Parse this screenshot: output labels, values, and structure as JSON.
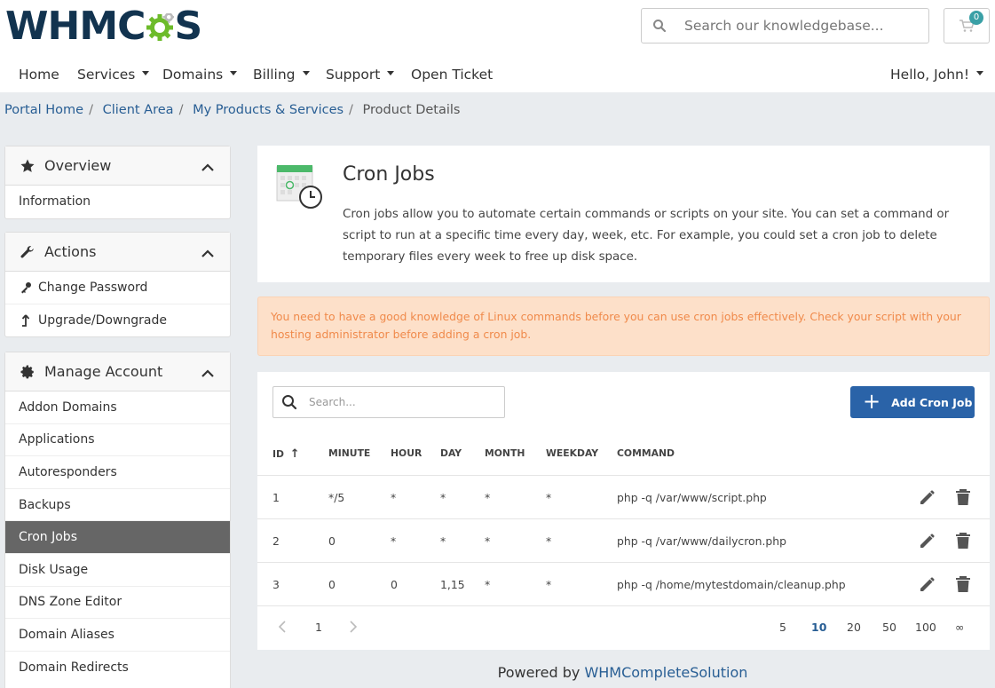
{
  "brand": {
    "logo_text_left": "WHMC",
    "logo_text_right": "S"
  },
  "header": {
    "search_placeholder": "Search our knowledgebase...",
    "cart_count": "0"
  },
  "nav": {
    "items": [
      "Home",
      "Services",
      "Domains",
      "Billing",
      "Support",
      "Open Ticket"
    ],
    "user_menu": "Hello, John!"
  },
  "breadcrumb": [
    "Portal Home",
    "Client Area",
    "My Products & Services",
    "Product Details"
  ],
  "sidebar": {
    "overview": {
      "title": "Overview",
      "items": [
        "Information"
      ]
    },
    "actions": {
      "title": "Actions",
      "items": [
        "Change Password",
        "Upgrade/Downgrade"
      ]
    },
    "manage": {
      "title": "Manage Account",
      "items": [
        "Addon Domains",
        "Applications",
        "Autoresponders",
        "Backups",
        "Cron Jobs",
        "Disk Usage",
        "DNS Zone Editor",
        "Domain Aliases",
        "Domain Redirects"
      ],
      "active": "Cron Jobs"
    }
  },
  "cron": {
    "title": "Cron Jobs",
    "description": "Cron jobs allow you to automate certain commands or scripts on your site. You can set a command or script to run at a specific time every day, week, etc. For example, you could set a cron job to delete temporary files every week to free up disk space."
  },
  "alert": "You need to have a good knowledge of Linux commands before you can use cron jobs effectively. Check your script with your hosting administrator before adding a cron job.",
  "table": {
    "search_placeholder": "Search...",
    "add_button": "Add Cron Job",
    "columns": [
      "ID",
      "MINUTE",
      "HOUR",
      "DAY",
      "MONTH",
      "WEEKDAY",
      "COMMAND"
    ],
    "rows": [
      [
        "1",
        "*/5",
        "*",
        "*",
        "*",
        "*",
        "php -q /var/www/script.php"
      ],
      [
        "2",
        "0",
        "*",
        "*",
        "*",
        "*",
        "php -q /var/www/dailycron.php"
      ],
      [
        "3",
        "0",
        "0",
        "1,15",
        "*",
        "*",
        "php -q /home/mytestdomain/cleanup.php"
      ]
    ],
    "pagination": {
      "current_page": "1",
      "page_sizes": [
        "5",
        "10",
        "20",
        "50",
        "100",
        "∞"
      ],
      "active_size": "10"
    }
  },
  "footer": {
    "prefix": "Powered by ",
    "link": "WHMCompleteSolution"
  },
  "colors": {
    "primary": "#2a63a8",
    "logo_dark": "#12334f",
    "logo_green": "#6dbb2b",
    "alert_bg": "#fde0c9",
    "alert_text": "#f08a4b"
  },
  "icons": {
    "search": "search-icon",
    "cart": "cart-icon",
    "star": "star-icon",
    "wrench": "wrench-icon",
    "key": "key-icon",
    "upgrade": "arrow-up-icon",
    "gear": "gear-icon",
    "edit": "pencil-icon",
    "delete": "trash-icon"
  }
}
